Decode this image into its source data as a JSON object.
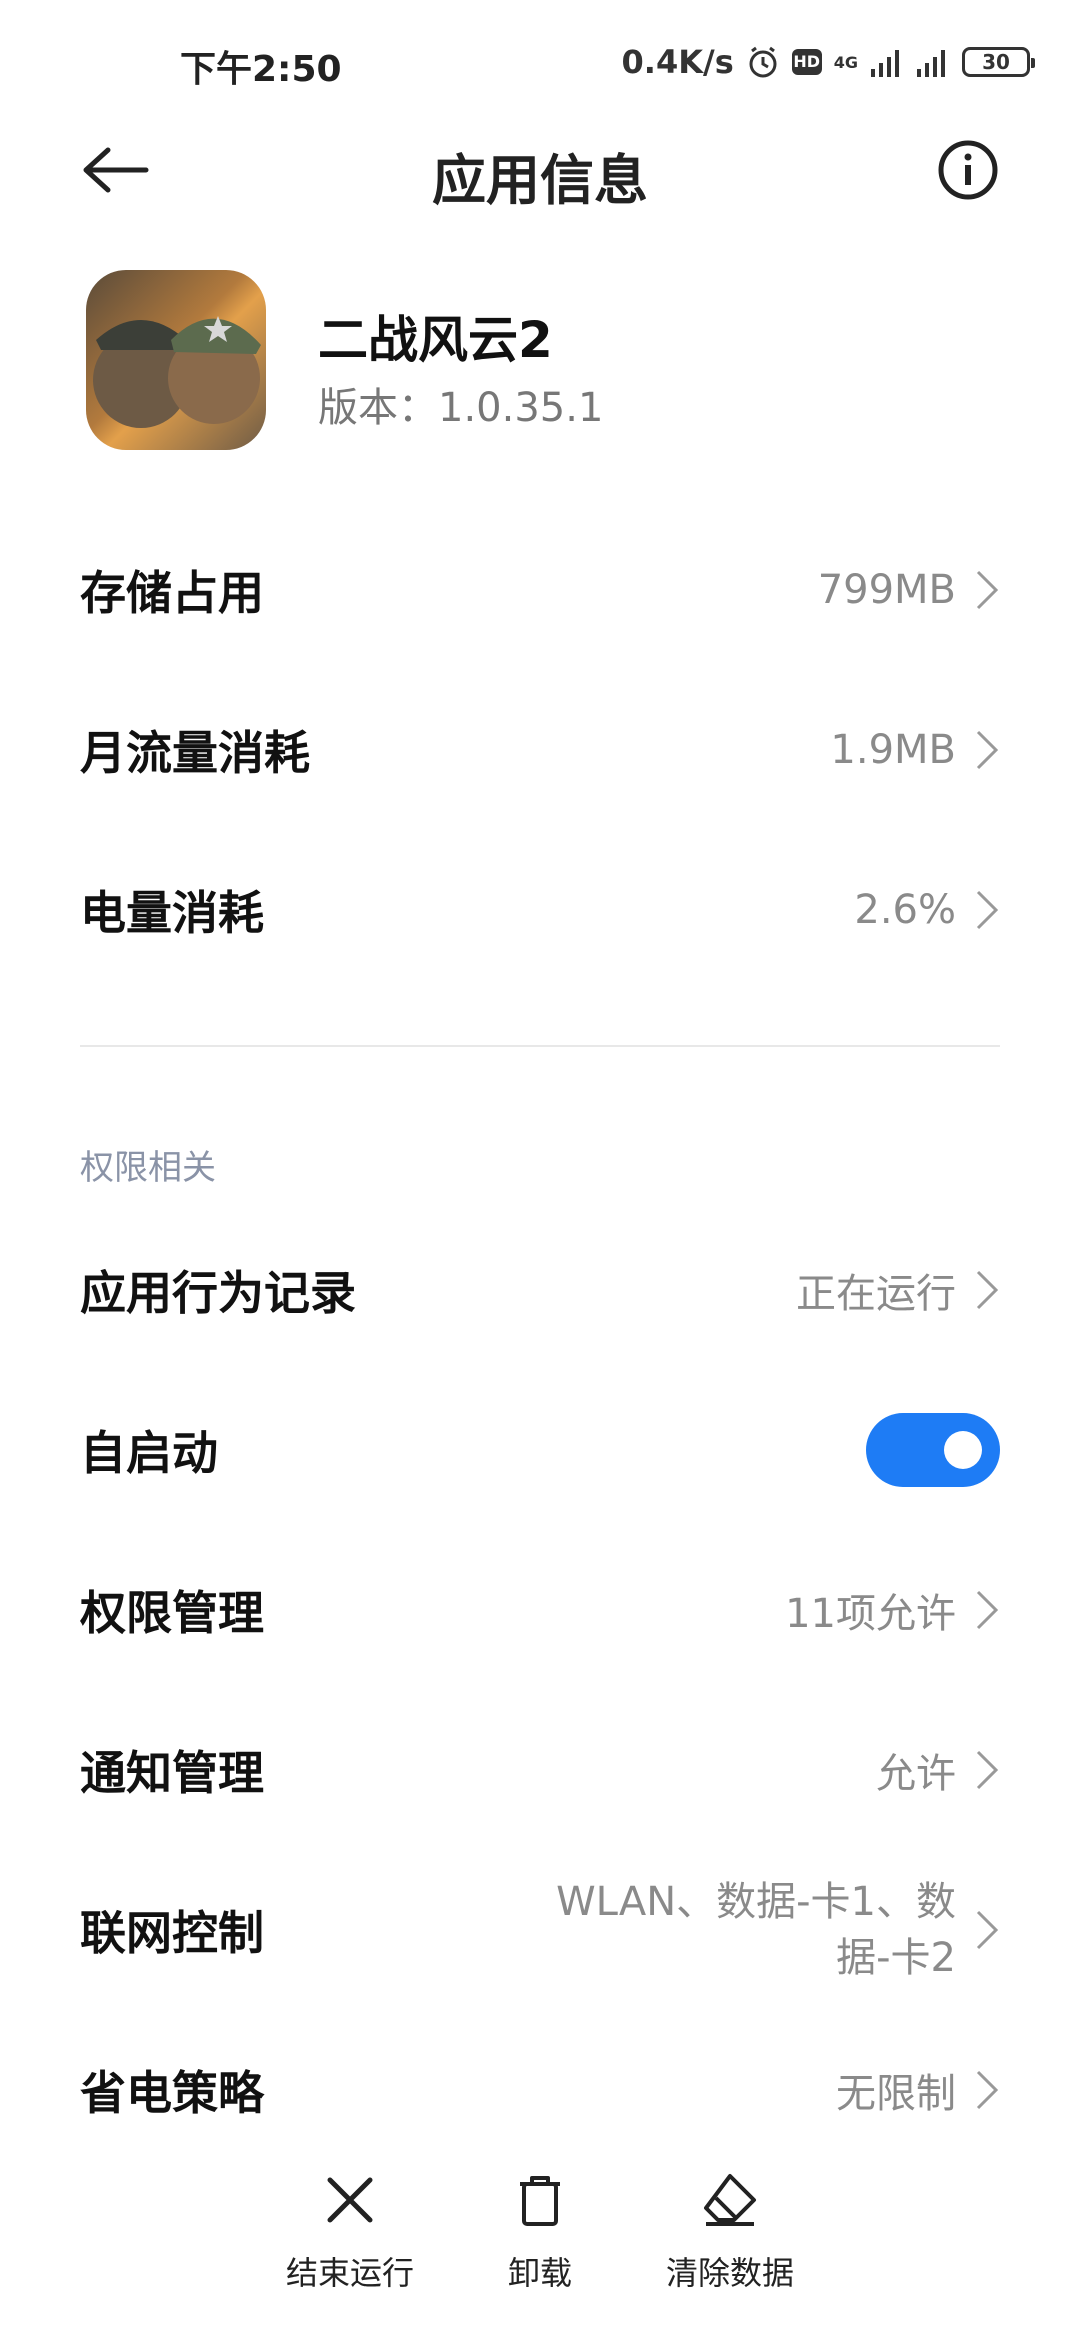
{
  "status_bar": {
    "time": "下午2:50",
    "net_speed": "0.4K/s",
    "hd_label": "HD",
    "network_type": "4G",
    "battery": "30",
    "icons": [
      "alarm-icon",
      "hd-icon",
      "signal-icon",
      "signal-icon",
      "battery-icon"
    ]
  },
  "header": {
    "title": "应用信息",
    "back_icon": "back-arrow-icon",
    "info_icon": "info-icon"
  },
  "app": {
    "name": "二战风云2",
    "version": "版本：1.0.35.1"
  },
  "usage": [
    {
      "label": "存储占用",
      "value": "799MB"
    },
    {
      "label": "月流量消耗",
      "value": "1.9MB"
    },
    {
      "label": "电量消耗",
      "value": "2.6%"
    }
  ],
  "permissions": {
    "section_label": "权限相关",
    "items": [
      {
        "label": "应用行为记录",
        "value": "正在运行"
      },
      {
        "label": "自启动",
        "toggle_on": true
      },
      {
        "label": "权限管理",
        "value": "11项允许"
      },
      {
        "label": "通知管理",
        "value": "允许"
      },
      {
        "label": "联网控制",
        "value_line1": "WLAN、数据-卡1、数",
        "value_line2": "据-卡2"
      },
      {
        "label": "省电策略",
        "value": "无限制"
      }
    ]
  },
  "actions": [
    {
      "label": "结束运行",
      "icon": "close-icon"
    },
    {
      "label": "卸载",
      "icon": "trash-icon"
    },
    {
      "label": "清除数据",
      "icon": "eraser-icon"
    }
  ],
  "colors": {
    "accent": "#1e7cf5",
    "secondary_text": "#8a8a8a",
    "section_label": "#8a93a7"
  }
}
